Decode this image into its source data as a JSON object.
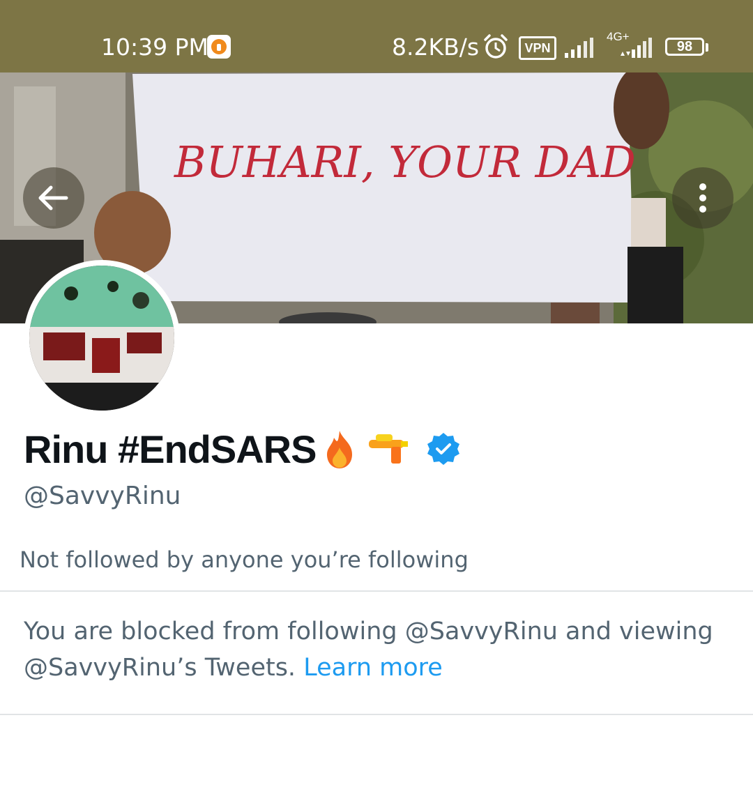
{
  "status_bar": {
    "time": "10:39 PM",
    "net_speed": "8.2KB/s",
    "vpn_label": "VPN",
    "network_type": "4G+",
    "battery": "98"
  },
  "banner": {
    "sign_text": "BUHARI, YOUR DAD"
  },
  "profile": {
    "display_name": "Rinu #EndSARS",
    "handle": "@SavvyRinu",
    "followed_by": "Not followed by anyone you’re following",
    "blocked_message_part1": "You are blocked from following @SavvyRinu and viewing @SavvyRinu’s Tweets.",
    "learn_more": "Learn more"
  },
  "icons": {
    "back": "arrow-left-icon",
    "more": "vertical-dots-icon",
    "verified": "verified-badge-icon"
  },
  "colors": {
    "status_bar_bg": "#7d7545",
    "text_primary": "#0f1419",
    "text_secondary": "#536471",
    "link": "#1d9bf0",
    "verified": "#1d9bf0"
  }
}
